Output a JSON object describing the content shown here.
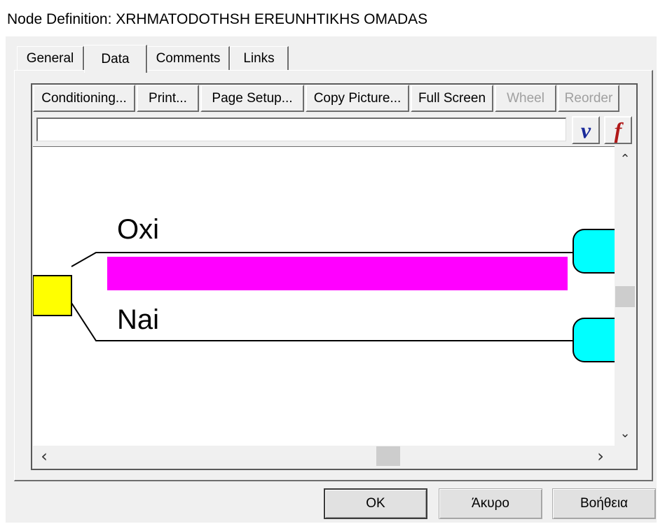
{
  "window": {
    "title": "Node Definition: XRHMATODOTHSH EREUNHTIKHS OMADAS"
  },
  "tabs": [
    {
      "label": "General"
    },
    {
      "label": "Data",
      "active": true
    },
    {
      "label": "Comments"
    },
    {
      "label": "Links"
    }
  ],
  "toolbar": {
    "conditioning_label": "Conditioning...",
    "print_label": "Print...",
    "page_setup_label": "Page Setup...",
    "copy_picture_label": "Copy Picture...",
    "full_screen_label": "Full Screen",
    "wheel_label": "Wheel",
    "reorder_label": "Reorder"
  },
  "formula": {
    "value": "",
    "v_button_glyph": "v",
    "f_button_glyph": "f",
    "v_color": "#1a2a9a",
    "f_color": "#b01818"
  },
  "tree": {
    "branches": [
      {
        "label": "Oxi"
      },
      {
        "label": "Nai"
      }
    ],
    "chance_node_color": "#ffff00",
    "terminal_node_color": "#00ffff",
    "probability_bar_color": "#ff00ff"
  },
  "scrollbars": {
    "up_icon": "⌃",
    "down_icon": "⌄",
    "left_icon": "‹",
    "right_icon": "›"
  },
  "buttons": {
    "ok_label": "OK",
    "cancel_label": "Άκυρο",
    "help_label": "Βοήθεια"
  }
}
